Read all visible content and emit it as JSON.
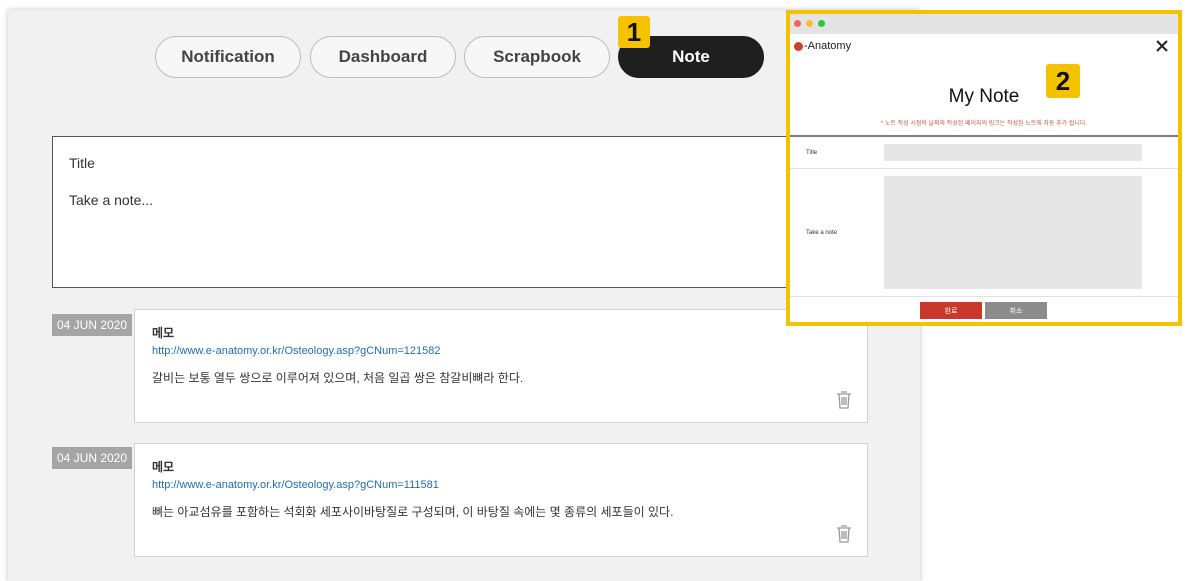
{
  "tabs": [
    {
      "label": "Notification"
    },
    {
      "label": "Dashboard"
    },
    {
      "label": "Scrapbook"
    },
    {
      "label": "Note"
    }
  ],
  "step_badges": [
    "1",
    "2"
  ],
  "note_input": {
    "title_placeholder": "Title",
    "body_placeholder": "Take a note..."
  },
  "notes": [
    {
      "date": "04 JUN 2020",
      "title": "메모",
      "link": "http://www.e-anatomy.or.kr/Osteology.asp?gCNum=121582",
      "text": "갈비는 보통 열두 쌍으로 이루어져 있으며, 처음 일곱 쌍은 참갈비뼈라 한다."
    },
    {
      "date": "04 JUN 2020",
      "title": "메모",
      "link": "http://www.e-anatomy.or.kr/Osteology.asp?gCNum=111581",
      "text": "뼈는 아교섬유를 포함하는 석회화 세포사이바탕질로 구성되며, 이 바탕질 속에는 몇 종류의 세포들이 있다."
    }
  ],
  "modal": {
    "logo": "-Anatomy",
    "heading": "My Note",
    "hint": "* 노트 작성 시점의 날짜와 작성된 페이지의 링크는 작성된 노트에 자동 추가 됩니다.",
    "title_label": "Title",
    "note_label": "Take a note",
    "confirm_label": "완료",
    "cancel_label": "취소"
  },
  "colors": {
    "badge": "#f5c200",
    "active_tab": "#1f1f1f",
    "confirm": "#c8392b",
    "cancel": "#8c8c8c",
    "link": "#1e6eb8"
  },
  "icons": [
    "trash-icon",
    "close-icon",
    "app-logo-icon"
  ]
}
